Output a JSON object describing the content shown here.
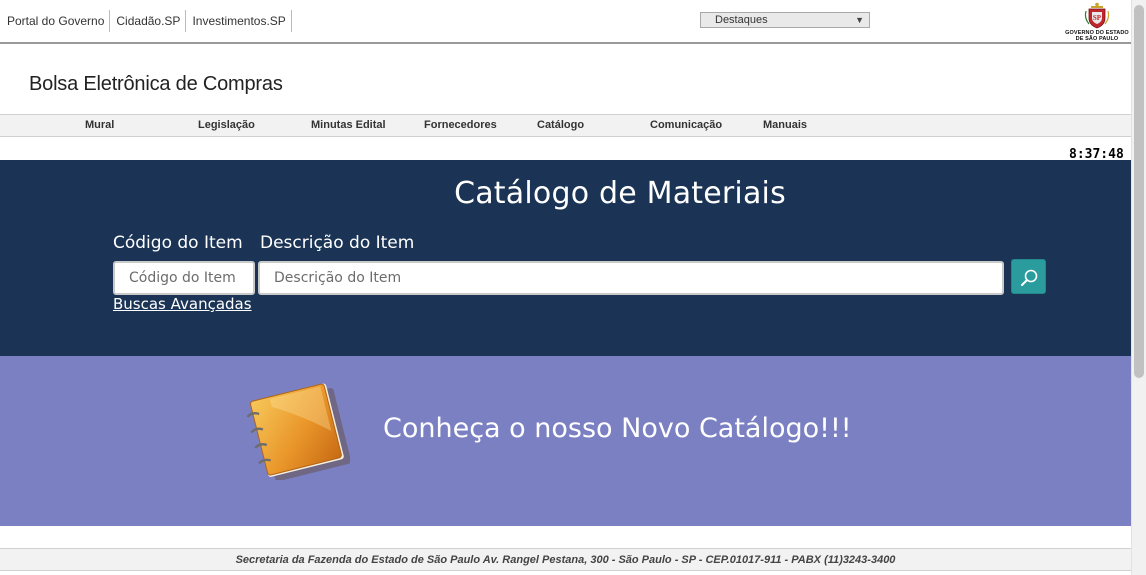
{
  "govbar": {
    "links": [
      "Portal do Governo",
      "Cidadão.SP",
      "Investimentos.SP"
    ],
    "destaques": "Destaques",
    "logo_caption_1": "GOVERNO DO ESTADO",
    "logo_caption_2": "DE SÃO PAULO"
  },
  "site": {
    "title": "Bolsa Eletrônica de Compras"
  },
  "menu": {
    "items": [
      "Mural",
      "Legislação",
      "Minutas Edital",
      "Fornecedores",
      "Catálogo",
      "Comunicação",
      "Manuais"
    ]
  },
  "clock": "8:37:48",
  "catalog": {
    "title": "Catálogo de Materiais",
    "code_label": "Código do Item",
    "desc_label": "Descrição do Item",
    "code_placeholder": "Código do Item",
    "desc_placeholder": "Descrição do Item",
    "advanced_link": "Buscas Avançadas"
  },
  "promo": {
    "text": "Conheça o nosso Novo Catálogo!!!"
  },
  "footer": {
    "text": "Secretaria da Fazenda do Estado de São Paulo Av. Rangel Pestana, 300 - São Paulo - SP - CEP.01017-911 - PABX (11)3243-3400"
  },
  "colors": {
    "band": "#1b3455",
    "promo": "#7b80c2",
    "search_button": "#2a9c9e"
  }
}
